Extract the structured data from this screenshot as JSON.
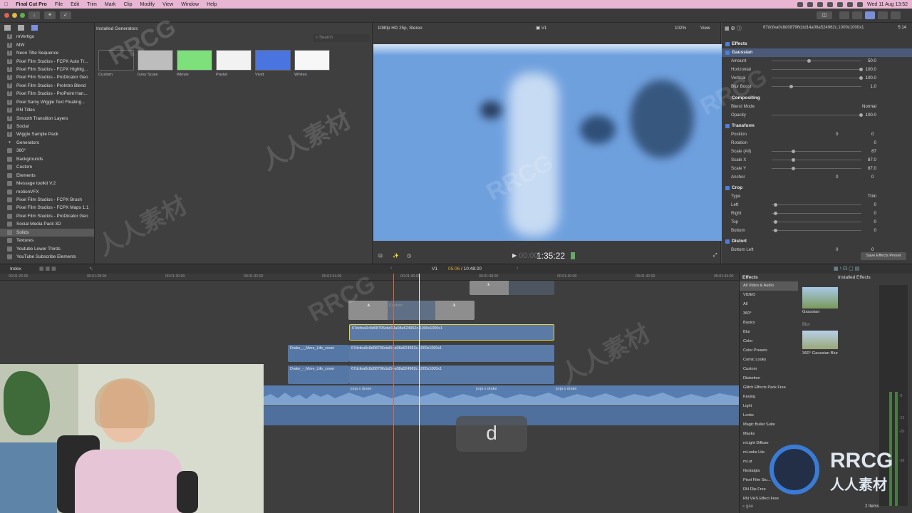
{
  "menubar": {
    "app": "Final Cut Pro",
    "menus": [
      "File",
      "Edit",
      "Trim",
      "Mark",
      "Clip",
      "Modify",
      "View",
      "Window",
      "Help"
    ],
    "datetime": "Wed 11 Aug  13:52"
  },
  "library": {
    "items": [
      {
        "label": "mVertigo",
        "type": "title"
      },
      {
        "label": "MW",
        "type": "title"
      },
      {
        "label": "Neon Title Sequence",
        "type": "title"
      },
      {
        "label": "Pixel Film Studios - FCPX Auto Tr...",
        "type": "title"
      },
      {
        "label": "Pixel Film Studios - FCPX Highlig...",
        "type": "title"
      },
      {
        "label": "Pixel Film Studios - ProDicator Geo",
        "type": "title"
      },
      {
        "label": "Pixel Film Studios - ProIntro Blend",
        "type": "title"
      },
      {
        "label": "Pixel Film Studios - ProPoint Han...",
        "type": "title"
      },
      {
        "label": "Pixel Samy Wiggle Text Floating...",
        "type": "title"
      },
      {
        "label": "RN Titles",
        "type": "title"
      },
      {
        "label": "Smooth Transition Layers",
        "type": "title"
      },
      {
        "label": "Social",
        "type": "title"
      },
      {
        "label": "Wiggle Sample Pack",
        "type": "title"
      },
      {
        "label": "Generators",
        "type": "header"
      },
      {
        "label": "360°",
        "type": "gen"
      },
      {
        "label": "Backgrounds",
        "type": "gen"
      },
      {
        "label": "Custom",
        "type": "gen"
      },
      {
        "label": "Elements",
        "type": "gen"
      },
      {
        "label": "Message toolkit V.2",
        "type": "gen"
      },
      {
        "label": "motionVFX",
        "type": "gen"
      },
      {
        "label": "Pixel Film Studios - FCPX Brush",
        "type": "gen"
      },
      {
        "label": "Pixel Film Studios - FCPX Maps 1.1",
        "type": "gen"
      },
      {
        "label": "Pixel Film Studios - ProDicator Geo",
        "type": "gen"
      },
      {
        "label": "Social Media Pack 3D",
        "type": "gen"
      },
      {
        "label": "Solids",
        "type": "gen",
        "selected": true
      },
      {
        "label": "Textures",
        "type": "gen"
      },
      {
        "label": "Youtube Lower Thirds",
        "type": "gen"
      },
      {
        "label": "YouTube Subscribe Elements",
        "type": "gen"
      }
    ]
  },
  "browser": {
    "title": "Installed Generators",
    "search_placeholder": "Search",
    "thumbs": [
      {
        "label": "Custom",
        "color": "#3a3a3a"
      },
      {
        "label": "Grey Scale",
        "color": "#bdbdbd"
      },
      {
        "label": "iMovie",
        "color": "#7ee07a"
      },
      {
        "label": "Pastel",
        "color": "#f2f2f2"
      },
      {
        "label": "Vivid",
        "color": "#4a74e0"
      },
      {
        "label": "Whites",
        "color": "#f7f7f7"
      }
    ]
  },
  "viewer": {
    "format": "1080p HD 25p, Stereo",
    "role": "V1",
    "zoom": "102%",
    "view": "View",
    "timecode": "1:35:22",
    "tc_prefix": "00:00"
  },
  "inspector": {
    "clip_name": "67dcfea0c8d08796cbd14a08a524962c.1000x1000x1",
    "duration": "5:14",
    "effects_label": "Effects",
    "gaussian": "Gaussian",
    "amount_label": "Amount",
    "amount": "50.0",
    "horizontal_label": "Horizontal",
    "horizontal": "100.0",
    "vertical_label": "Vertical",
    "vertical": "100.0",
    "blurboost_label": "Blur Boost",
    "blurboost": "1.0",
    "compositing": "Compositing",
    "blend_label": "Blend Mode",
    "blend": "Normal",
    "opacity_label": "Opacity",
    "opacity": "100.0",
    "transform": "Transform",
    "position_label": "Position",
    "pos_x": "0",
    "pos_y": "0",
    "rotation_label": "Rotation",
    "rotation": "0",
    "scaleall_label": "Scale (All)",
    "scaleall": "87",
    "scalex_label": "Scale X",
    "scalex": "87.0",
    "scaley_label": "Scale Y",
    "scaley": "87.0",
    "anchor_label": "Anchor",
    "anc_x": "0",
    "anc_y": "0",
    "crop": "Crop",
    "type_label": "Type",
    "type": "Trim",
    "left_label": "Left",
    "left": "0",
    "right_label": "Right",
    "right": "0",
    "top_label": "Top",
    "top": "0",
    "bottom_label": "Bottom",
    "bottom": "0",
    "distort": "Distort",
    "bottomleft_label": "Bottom Left",
    "bl_x": "0",
    "bl_y": "0",
    "save_preset": "Save Effects Preset"
  },
  "timeline": {
    "index": "Index",
    "role": "V1",
    "position": "05:06",
    "total": "10:48:20",
    "ruler": [
      "00:01:26:00",
      "00:01:28:00",
      "00:01:30:00",
      "00:01:32:00",
      "00:01:34:00",
      "00:01:36:00",
      "00:01:38:00",
      "00:01:40:00",
      "00:01:42:00",
      "00:01:44:00"
    ],
    "custom_label": "Custom",
    "clip_name": "67dcfea0c8d08796cbd14a08a524962c.1000x1000x1",
    "clip_short": "67dcfea0c8d08796cbd14a08a524962c.1000x1000x1",
    "drake_clip": "Drake_-_More_Life_cover",
    "audio_label": "jorja x drake",
    "key_overlay": "d"
  },
  "effects": {
    "title": "Effects",
    "installed": "Installed Effects",
    "categories": [
      "All Video & Audio",
      "VIDEO",
      "All",
      "360°",
      "Basics",
      "Blur",
      "Color",
      "Color Presets",
      "Comic Looks",
      "Custom",
      "Distortion",
      "Glitch Effects Pack Free",
      "Keying",
      "Light",
      "Looks",
      "Magic Bullet Suite",
      "Masks",
      "mLight Diffuse",
      "mLooks Lite",
      "mLut",
      "Nostalgia",
      "Pixel Film Stu...",
      "RN Flip Free",
      "RN VHS Effect Free"
    ],
    "results": [
      {
        "label": "Gaussian"
      },
      {
        "label": "360° Gaussian Blur"
      }
    ],
    "blur_header": "Blur",
    "search_value": "gau",
    "count": "2 Items",
    "meter": [
      "-6",
      "-12",
      "-20",
      "-30"
    ]
  },
  "watermark": {
    "rrcg": "RRCG",
    "cn": "人人素材"
  }
}
